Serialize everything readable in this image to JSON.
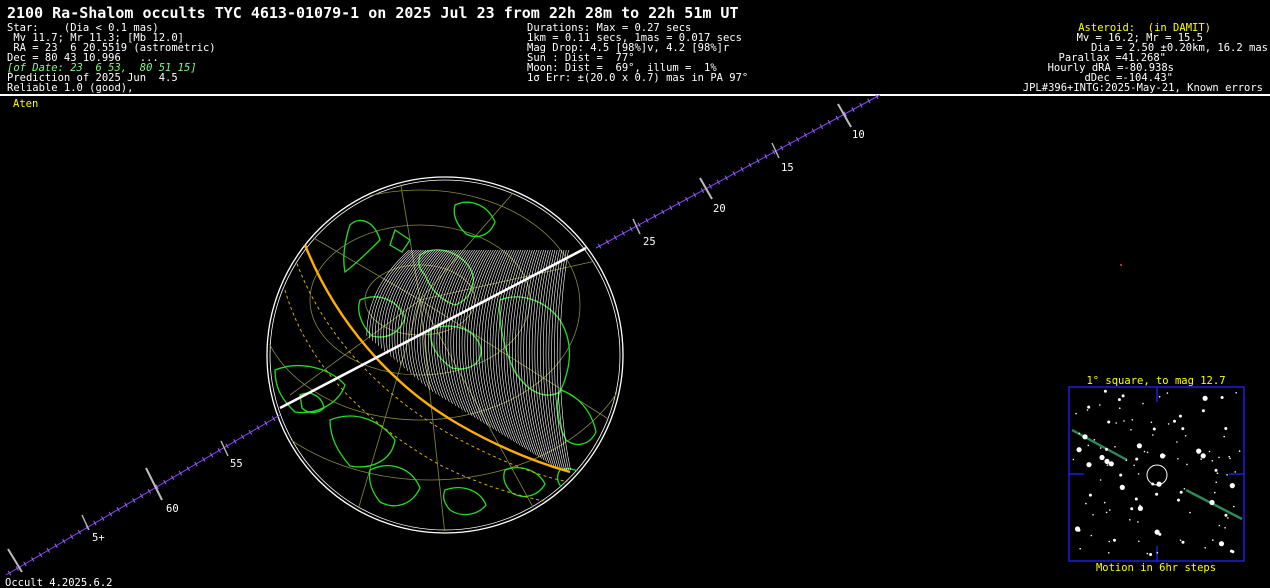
{
  "title": "2100 Ra-Shalom occults TYC 4613-01079-1 on 2025 Jul 23 from 22h 28m to 22h 51m UT",
  "left_panel": [
    "Star:    (Dia < 0.1 mas)",
    " Mv 11.7; Mr 11.3; [Mb 12.0]",
    " RA = 23  6 20.5519 (astrometric)",
    "Dec = 80 43 10.996   ...",
    "[of Date: 23  6 53,  80 51 15]",
    "Prediction of 2025 Jun  4.5",
    "Reliable 1.0 (good),"
  ],
  "middle_panel": [
    "Durations: Max = 0.27 secs",
    "1km = 0.11 secs, 1mas = 0.017 secs",
    "Mag Drop: 4.5 [98%]v, 4.2 [98%]r",
    "Sun : Dist =  77°",
    "Moon: Dist =  69°, illum =  1%",
    "1σ Err: ±(20.0 x 0.7) mas in PA 97°"
  ],
  "right_panel": [
    "Asteroid:  (in DAMIT)",
    "Mv = 16.2; Mr = 15.5",
    "Dia = 2.50 ±0.20km, 16.2 mas",
    "Parallax =41.268\"",
    "Hourly dRA =-80.938s",
    "dDec =-104.43\"",
    "JPL#396+INTG:2025-May-21, Known errors"
  ],
  "orbit_class": "Aten",
  "time_ticks": [
    "10",
    "15",
    "20",
    "25",
    "55",
    "60",
    "5+"
  ],
  "finder": {
    "title": "1° square, to mag 12.7",
    "caption": "Motion in 6hr steps"
  },
  "footer": "Occult 4.2025.6.2",
  "colors": {
    "background": "#000000",
    "text": "#ffffff",
    "highlight": "#ffff00",
    "land": "#22dd22",
    "shadow_path": "#ffffff",
    "limit_lines": "#ffa500",
    "track_ticks": "#8844ff",
    "finder_border": "#2222ff",
    "asteroid_motion": "#2e8b57"
  }
}
